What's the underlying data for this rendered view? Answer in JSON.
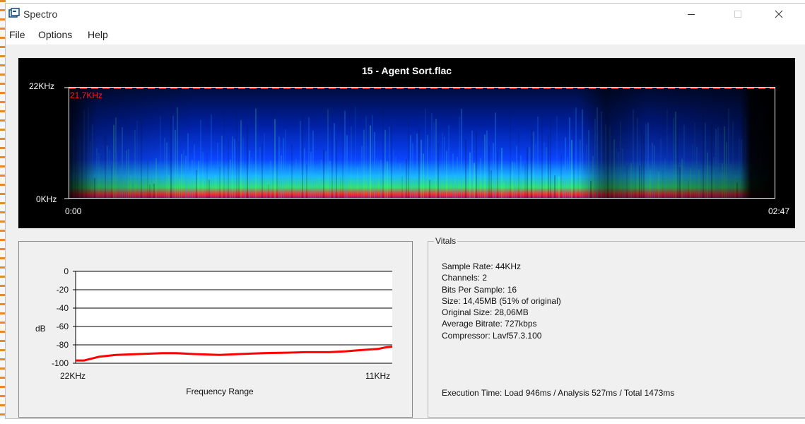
{
  "window": {
    "title": "Spectro",
    "controls": [
      "minimize",
      "maximize",
      "close"
    ]
  },
  "menu": [
    "File",
    "Options",
    "Help"
  ],
  "spectrogram": {
    "title": "15 - Agent Sort.flac",
    "y_top_label": "22KHz",
    "y_bottom_label": "0KHz",
    "cutoff_label": "21,7KHz",
    "x_start": "0:00",
    "x_end": "02:47",
    "colors": {
      "cutoff": "#ff0000",
      "background": "#000000"
    }
  },
  "frequency_chart": {
    "ylabel": "dB",
    "xlabel": "Frequency Range",
    "y_ticks": [
      "0",
      "-20",
      "-40",
      "-60",
      "-80",
      "-100"
    ],
    "x_ticks": [
      "22KHz",
      "11KHz"
    ]
  },
  "chart_data": {
    "type": "line",
    "title": "",
    "xlabel": "Frequency Range",
    "ylabel": "dB",
    "ylim": [
      -100,
      0
    ],
    "x_ticks": [
      "22KHz",
      "11KHz"
    ],
    "x_range": [
      22,
      11
    ],
    "series": [
      {
        "color": "#ff0000",
        "points": [
          [
            22,
            -97
          ],
          [
            21.7,
            -97
          ],
          [
            21.2,
            -93
          ],
          [
            20.6,
            -91
          ],
          [
            19.8,
            -90
          ],
          [
            19.0,
            -89
          ],
          [
            18.5,
            -89
          ],
          [
            17.9,
            -90
          ],
          [
            17.0,
            -91
          ],
          [
            16.3,
            -90
          ],
          [
            15.5,
            -89
          ],
          [
            14.7,
            -88.5
          ],
          [
            14.0,
            -88
          ],
          [
            13.2,
            -88
          ],
          [
            12.6,
            -87
          ],
          [
            12.0,
            -85.5
          ],
          [
            11.5,
            -84.5
          ],
          [
            11.2,
            -82.5
          ],
          [
            11.0,
            -82
          ]
        ]
      }
    ],
    "grid": true
  },
  "vitals": {
    "legend": "Vitals",
    "lines": [
      "Sample Rate: 44KHz",
      "Channels: 2",
      "Bits Per Sample: 16",
      "Size: 14,45MB (51% of original)",
      "Original Size: 28,06MB",
      "Average Bitrate: 727kbps",
      "Compressor: Lavf57.3.100"
    ],
    "execution": "Execution Time: Load 946ms / Analysis 527ms / Total 1473ms"
  }
}
